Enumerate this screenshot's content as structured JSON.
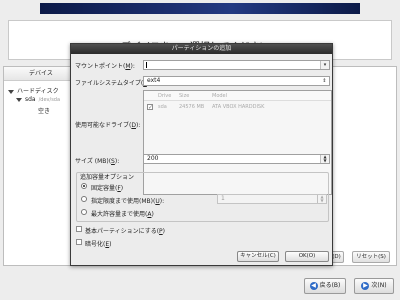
{
  "heading": "デバイスを 1つ選択してください。",
  "device_panel": {
    "column_header": "デバイス",
    "tree": [
      {
        "label": "ハードディスク"
      },
      {
        "label": "sda",
        "sub": "/dev/sda"
      },
      {
        "label": "空き"
      }
    ],
    "buttons": [
      "削除(D)",
      "リセット(S)"
    ]
  },
  "bottom_buttons": {
    "back": "戻る(B)",
    "next": "次(N)"
  },
  "dialog": {
    "title": "パーティションの追加",
    "mount_point": {
      "label": "マウントポイント(",
      "key": "M",
      "suffix": "):",
      "value": ""
    },
    "fs_type": {
      "label": "ファイルシステムタイプ(",
      "key": "T",
      "suffix": "):",
      "value": "ext4"
    },
    "drives": {
      "label": "使用可能なドライブ(",
      "key": "D",
      "suffix": "):",
      "headers": [
        "Drive",
        "Size",
        "Model"
      ],
      "rows": [
        {
          "checked": true,
          "drive": "sda",
          "size": "24576 MB",
          "model": "ATA VBOX HARDDISK"
        }
      ]
    },
    "size": {
      "label": "サイズ (MB)(",
      "key": "S",
      "suffix": "):",
      "value": "200"
    },
    "options_title": "追加容量オプション",
    "options": [
      {
        "label": "固定容量(",
        "key": "F",
        "suffix": ")",
        "selected": true
      },
      {
        "label": "指定限度まで使用(MB)(",
        "key": "U",
        "suffix": "):",
        "selected": false
      },
      {
        "label": "最大許容量まで使用(",
        "key": "A",
        "suffix": ")",
        "selected": false
      }
    ],
    "limit_value": "1",
    "primary_check": {
      "label": "基本パーティションにする(",
      "key": "P",
      "suffix": ")",
      "checked": false
    },
    "encrypt_check": {
      "label": "暗号化(",
      "key": "E",
      "suffix": ")",
      "checked": false
    },
    "cancel": "キャンセル(C)",
    "ok": "OK(O)"
  }
}
